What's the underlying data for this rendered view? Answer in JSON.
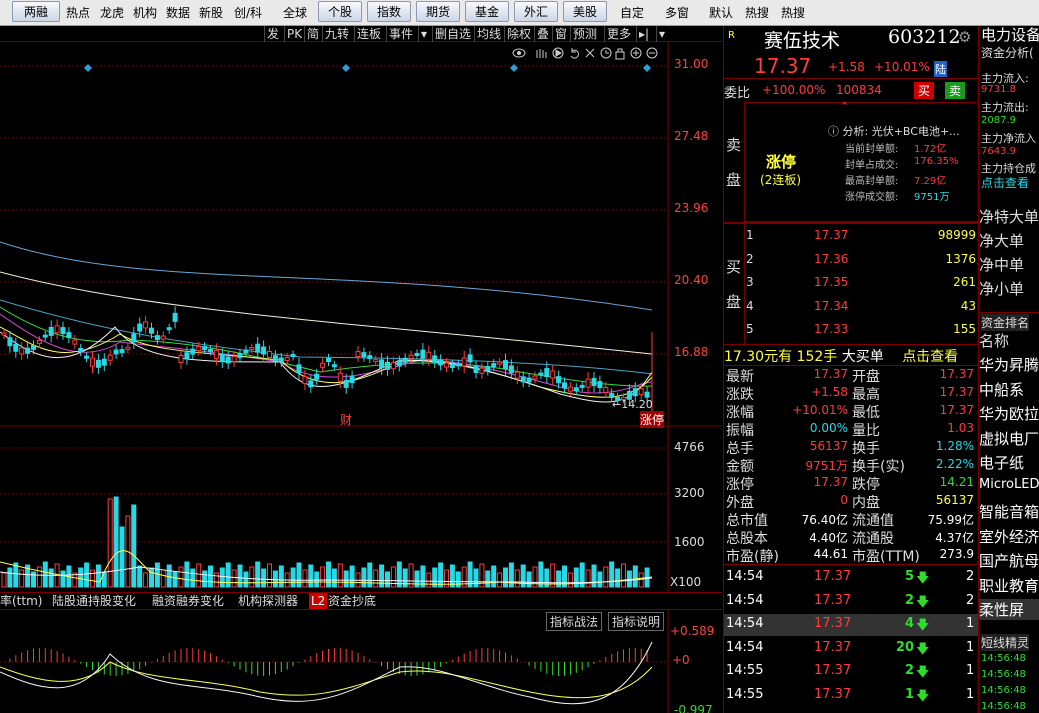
{
  "topnav": {
    "items": [
      "两融",
      "热点",
      "龙虎",
      "机构",
      "数据",
      "新股",
      "创/科",
      "全球",
      "个股",
      "指数",
      "期货",
      "基金",
      "外汇",
      "美股",
      "自定",
      "多窗",
      "默认",
      "热搜",
      "热搜"
    ]
  },
  "chart_toolbar": {
    "items": [
      "发",
      "PK",
      "简",
      "九转",
      "连板",
      "事件",
      "▾",
      "删自选",
      "均线",
      "除权",
      "叠",
      "窗",
      "预测",
      "更多",
      "▸|",
      "▾"
    ]
  },
  "price_axis": [
    "31.00",
    "27.48",
    "23.96",
    "20.40",
    "16.88"
  ],
  "vol_axis": [
    "4766",
    "3200",
    "1600",
    "X100"
  ],
  "macd_axis": [
    "+0.589",
    "+0",
    "-0.997"
  ],
  "annotations": {
    "low_price": "←14.20",
    "fin": "财",
    "limit": "涨停"
  },
  "indicator_tabs": [
    "率(ttm)",
    "陆股通持股变化",
    "融资融券变化",
    "机构探测器",
    "L2",
    "资金抄底"
  ],
  "indicator_buttons": [
    "指标战法",
    "指标说明"
  ],
  "stock": {
    "badge": "R",
    "name": "赛伍技术",
    "code": "603212",
    "price": "17.37",
    "change": "+1.58",
    "pct": "+10.01%",
    "market": "陆"
  },
  "weibi": {
    "label": "委比",
    "ratio": "+100.00%",
    "diff": "100834",
    "buy": "买",
    "sell": "卖"
  },
  "sell_label": [
    "卖",
    "盘"
  ],
  "limit_info": {
    "title": "涨停",
    "sub": "(2连板)",
    "analysis": "分析: 光伏+BC电池+...",
    "rows": [
      [
        "当前封单额:",
        "1.72亿"
      ],
      [
        "封单占成交:",
        "176.35%"
      ],
      [
        "最高封单额:",
        "7.29亿"
      ],
      [
        "涨停成交额:",
        "9751万"
      ]
    ]
  },
  "buy_label": [
    "买",
    "盘"
  ],
  "bids": [
    [
      "1",
      "17.37",
      "98999"
    ],
    [
      "2",
      "17.36",
      "1376"
    ],
    [
      "3",
      "17.35",
      "261"
    ],
    [
      "4",
      "17.34",
      "43"
    ],
    [
      "5",
      "17.33",
      "155"
    ]
  ],
  "big_order": {
    "price": "17.30元有",
    "qty": "152手",
    "type": "大买单",
    "action": "点击查看"
  },
  "stats": [
    [
      "最新",
      "17.37",
      "开盘",
      "17.37"
    ],
    [
      "涨跌",
      "+1.58",
      "最高",
      "17.37"
    ],
    [
      "涨幅",
      "+10.01%",
      "最低",
      "17.37"
    ],
    [
      "振幅",
      "0.00%",
      "量比",
      "1.03"
    ],
    [
      "总手",
      "56137",
      "换手",
      "1.28%"
    ],
    [
      "金额",
      "9751万",
      "换手(实)",
      "2.22%"
    ],
    [
      "涨停",
      "17.37",
      "跌停",
      "14.21"
    ],
    [
      "外盘",
      "0",
      "内盘",
      "56137"
    ],
    [
      "总市值",
      "76.40亿",
      "流通值",
      "75.99亿"
    ],
    [
      "总股本",
      "4.40亿",
      "流通股",
      "4.37亿"
    ],
    [
      "市盈(静)",
      "44.61",
      "市盈(TTM)",
      "273.9"
    ]
  ],
  "ticks": [
    [
      "14:54",
      "17.37",
      "5",
      "2"
    ],
    [
      "14:54",
      "17.37",
      "2",
      "2"
    ],
    [
      "14:54",
      "17.37",
      "4",
      "1"
    ],
    [
      "14:54",
      "17.37",
      "20",
      "1"
    ],
    [
      "14:55",
      "17.37",
      "2",
      "1"
    ],
    [
      "14:55",
      "17.37",
      "1",
      "1"
    ]
  ],
  "far_panel": {
    "title": "电力设备",
    "sub": "资金分析(",
    "flows": [
      [
        "主力流入:",
        "9731.8"
      ],
      [
        "主力流出:",
        "2087.9"
      ],
      [
        "主力净流入",
        "7643.9"
      ],
      [
        "主力持仓成",
        ""
      ]
    ],
    "click": "点击查看",
    "cats": [
      "净特大单",
      "净大单",
      "净中单",
      "净小单"
    ],
    "rank_title": "资金排名",
    "rank_head": "名称",
    "rank": [
      "华为昇腾",
      "中船系",
      "华为欧拉",
      "虚拟电厂",
      "电子纸",
      "MicroLED",
      "智能音箱",
      "室外经济",
      "国产航母",
      "职业教育",
      "柔性屏"
    ],
    "short_title": "短线精灵",
    "short_times": [
      "14:56:48",
      "14:56:48",
      "14:56:48",
      "14:56:48"
    ]
  }
}
